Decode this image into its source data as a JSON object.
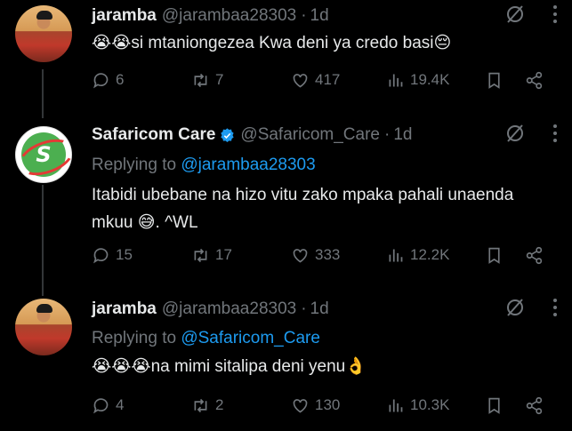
{
  "tweets": [
    {
      "name": "jaramba",
      "handle": "@jarambaa28303",
      "dot": "·",
      "time": "1d",
      "verified": false,
      "reply_prefix": "",
      "reply_to": "",
      "text_lines": [
        "😭😭si mtaniongezea Kwa deni ya credo basi😔"
      ],
      "replies": "6",
      "retweets": "7",
      "likes": "417",
      "views": "19.4K"
    },
    {
      "name": "Safaricom Care",
      "handle": "@Safaricom_Care",
      "dot": "·",
      "time": "1d",
      "verified": true,
      "reply_prefix": "Replying to ",
      "reply_to": "@jarambaa28303",
      "text_lines": [
        "Itabidi ubebane na hizo vitu zako mpaka pahali unaenda",
        "mkuu 😅. ^WL"
      ],
      "replies": "15",
      "retweets": "17",
      "likes": "333",
      "views": "12.2K"
    },
    {
      "name": "jaramba",
      "handle": "@jarambaa28303",
      "dot": "·",
      "time": "1d",
      "verified": false,
      "reply_prefix": "Replying to ",
      "reply_to": "@Safaricom_Care",
      "text_lines": [
        "😭😭😭na mimi sitalipa deni yenu👌"
      ],
      "replies": "4",
      "retweets": "2",
      "likes": "130",
      "views": "10.3K"
    }
  ],
  "saf_logo_letter": "S",
  "colors": {
    "background": "#000000",
    "text": "#e7e9ea",
    "muted": "#71767b",
    "link": "#1d9bf0",
    "verified": "#1d9bf0"
  }
}
